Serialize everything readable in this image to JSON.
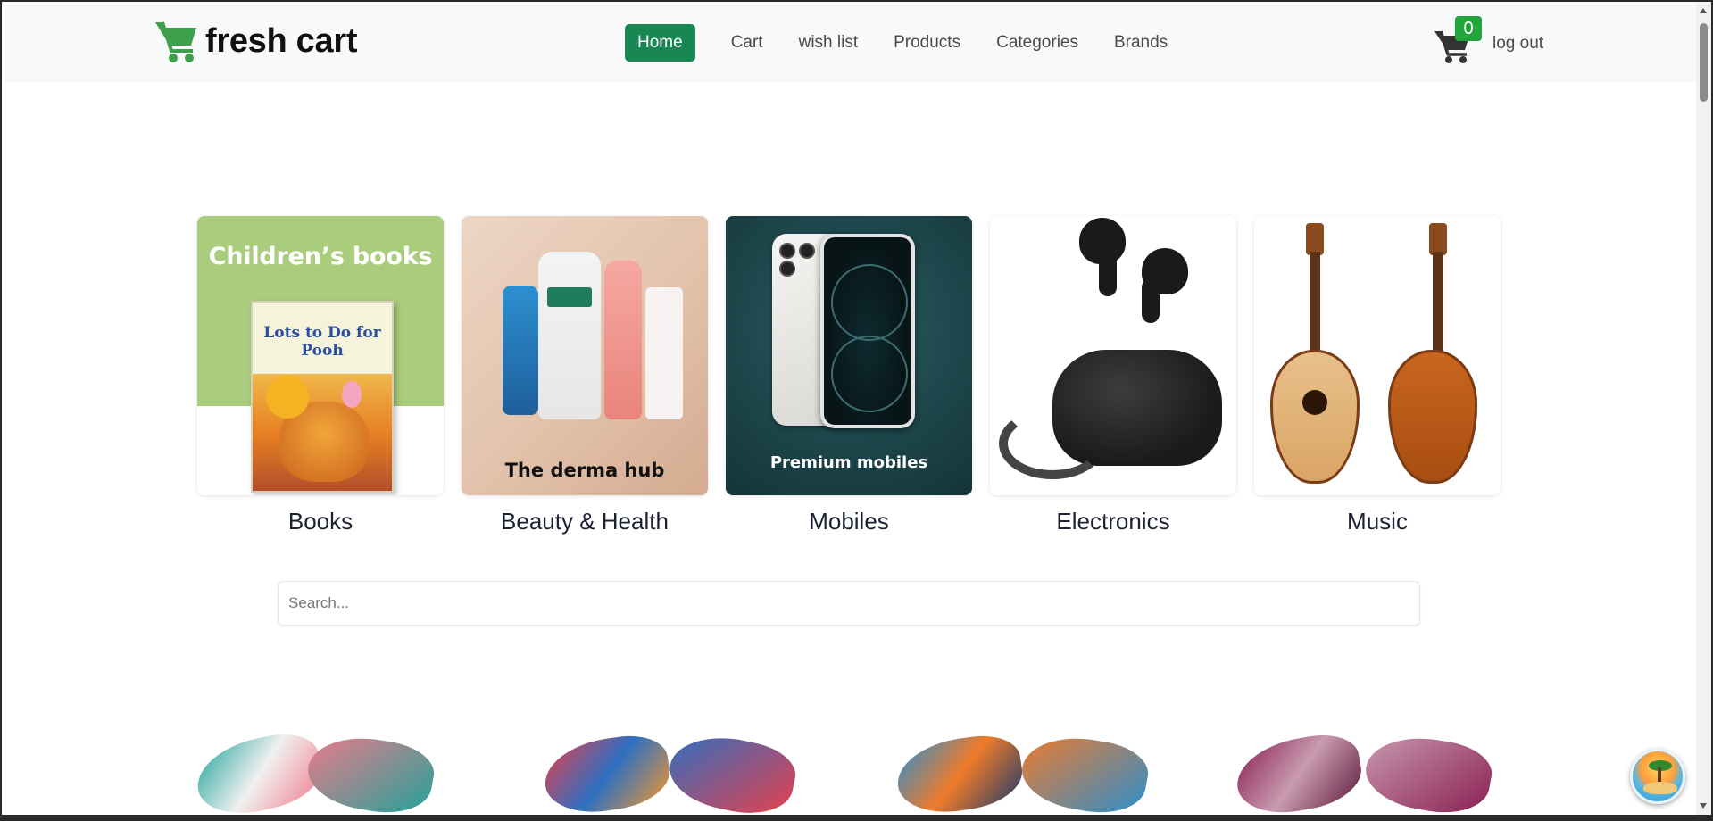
{
  "brand": {
    "name": "fresh cart",
    "logo_icon": "cart-icon",
    "color": "#3ea04a"
  },
  "nav": {
    "links": [
      {
        "label": "Home",
        "active": true
      },
      {
        "label": "Cart",
        "active": false
      },
      {
        "label": "wish list",
        "active": false
      },
      {
        "label": "Products",
        "active": false
      },
      {
        "label": "Categories",
        "active": false
      },
      {
        "label": "Brands",
        "active": false
      }
    ],
    "cart_count": "0",
    "logout_label": "log out",
    "active_color": "#198754"
  },
  "categories": [
    {
      "name": "Books",
      "image_text": "Children’s books"
    },
    {
      "name": "Beauty & Health",
      "image_text": "The derma hub"
    },
    {
      "name": "Mobiles",
      "image_text": "Premium mobiles"
    },
    {
      "name": "Electronics"
    },
    {
      "name": "Music"
    }
  ],
  "search": {
    "placeholder": "Search...",
    "value": ""
  },
  "book_cover": {
    "title": "Lots to Do for Pooh"
  },
  "products": [
    {
      "name": "scarf-1",
      "colors": [
        "#1fa39a",
        "#f07a8a"
      ]
    },
    {
      "name": "scarf-2",
      "colors": [
        "#e8404a",
        "#2e6fc2"
      ]
    },
    {
      "name": "scarf-3",
      "colors": [
        "#2a8fcf",
        "#f07b2a"
      ]
    },
    {
      "name": "scarf-4",
      "colors": [
        "#8a1e52",
        "#c89bb0"
      ]
    }
  ]
}
